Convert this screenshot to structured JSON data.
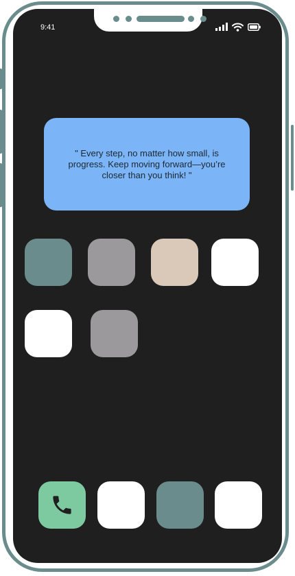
{
  "status_bar": {
    "time": "9:41",
    "icons": [
      "signal-icon",
      "wifi-icon",
      "battery-icon"
    ]
  },
  "widget": {
    "quote": "\" Every step, no matter how small, is progress. Keep moving forward—you’re closer than you think! \""
  },
  "home_apps": [
    {
      "color": "#6a8c8c"
    },
    {
      "color": "#9b999b"
    },
    {
      "color": "#dac8b8"
    },
    {
      "color": "#ffffff"
    },
    {
      "color": "#ffffff"
    },
    {
      "color": "#9b999b"
    }
  ],
  "dock": [
    {
      "icon": "phone-icon",
      "color": "#7ecaa0"
    },
    {
      "color": "#ffffff"
    },
    {
      "color": "#6a8c8c"
    },
    {
      "color": "#ffffff"
    }
  ],
  "theme": {
    "frame": "#6a8c8c",
    "screen": "#1f1f1f",
    "widget": "#7cb5f7"
  }
}
